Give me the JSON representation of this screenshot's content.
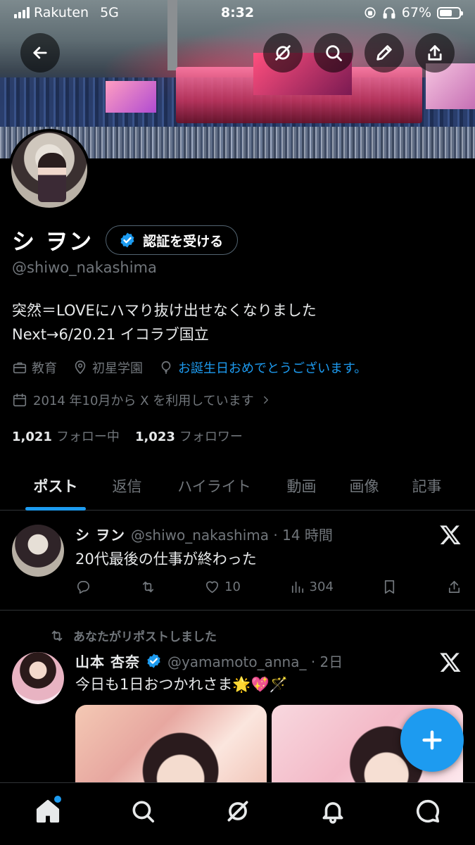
{
  "status_bar": {
    "carrier": "Rakuten",
    "network": "5G",
    "time": "8:32",
    "battery": "67%",
    "battery_level": 0.67
  },
  "profile": {
    "name": "シ ヲン",
    "verify_button": "認証を受ける",
    "handle": "@shiwo_nakashima",
    "bio_line1": "突然＝LOVEにハマり抜け出せなくなりました",
    "bio_line2": "Next→6/20.21 イコラブ国立",
    "category": "教育",
    "location": "初星学園",
    "birthday_link": "お誕生日おめでとうございます。",
    "joined": "2014 年10月から X を利用しています",
    "following_count": "1,021",
    "following_label": "フォロー中",
    "followers_count": "1,023",
    "followers_label": "フォロワー"
  },
  "tabs": [
    {
      "label": "ポスト",
      "active": true
    },
    {
      "label": "返信"
    },
    {
      "label": "ハイライト"
    },
    {
      "label": "動画"
    },
    {
      "label": "画像"
    },
    {
      "label": "記事"
    }
  ],
  "posts": [
    {
      "author": "シ ヲン",
      "handle_time": "@shiwo_nakashima · 14 時間",
      "text": "20代最後の仕事が終わった",
      "likes": "10",
      "views": "304"
    },
    {
      "repost_label": "あなたがリポストしました",
      "author": "山本 杏奈",
      "handle_time": "@yamamoto_anna_ · 2日",
      "text": "今日も1日おつかれさま🌟💖🪄"
    }
  ],
  "icons": {
    "back": "back-arrow-icon",
    "grok": "grok-icon",
    "search": "search-icon",
    "edit": "pencil-icon",
    "share": "share-icon",
    "home": "home-icon",
    "notifications": "bell-icon",
    "messages": "message-icon",
    "compose": "plus-icon"
  },
  "colors": {
    "accent": "#1d9bf0",
    "background": "#000000",
    "secondary_text": "#71767b"
  }
}
